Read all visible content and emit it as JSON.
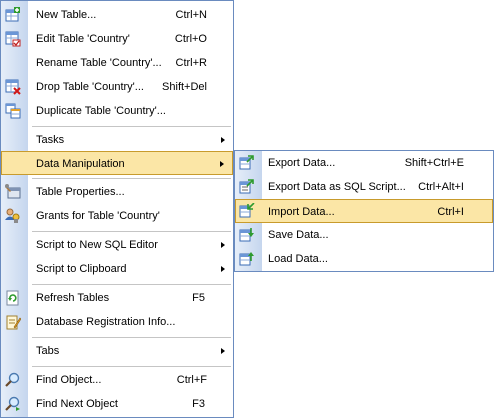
{
  "main_menu": {
    "new_table": {
      "label": "New Table...",
      "shortcut": "Ctrl+N",
      "icon": "new-table-icon"
    },
    "edit_table": {
      "label": "Edit Table 'Country'",
      "shortcut": "Ctrl+O",
      "icon": "edit-table-icon"
    },
    "rename_table": {
      "label": "Rename Table 'Country'...",
      "shortcut": "Ctrl+R"
    },
    "drop_table": {
      "label": "Drop Table 'Country'...",
      "shortcut": "Shift+Del",
      "icon": "drop-table-icon"
    },
    "duplicate_table": {
      "label": "Duplicate Table 'Country'...",
      "icon": "duplicate-table-icon"
    },
    "tasks": {
      "label": "Tasks"
    },
    "data_manipulation": {
      "label": "Data Manipulation"
    },
    "table_properties": {
      "label": "Table Properties...",
      "icon": "table-properties-icon"
    },
    "grants": {
      "label": "Grants for Table 'Country'",
      "icon": "grants-icon"
    },
    "script_sql_editor": {
      "label": "Script to New SQL Editor"
    },
    "script_clipboard": {
      "label": "Script to Clipboard"
    },
    "refresh_tables": {
      "label": "Refresh Tables",
      "shortcut": "F5",
      "icon": "refresh-icon"
    },
    "db_registration": {
      "label": "Database Registration Info...",
      "icon": "db-registration-icon"
    },
    "tabs": {
      "label": "Tabs"
    },
    "find_object": {
      "label": "Find Object...",
      "shortcut": "Ctrl+F",
      "icon": "find-icon"
    },
    "find_next": {
      "label": "Find Next Object",
      "shortcut": "F3",
      "icon": "find-next-icon"
    }
  },
  "submenu": {
    "export_data": {
      "label": "Export Data...",
      "shortcut": "Shift+Ctrl+E",
      "icon": "export-data-icon"
    },
    "export_sql": {
      "label": "Export Data as SQL Script...",
      "shortcut": "Ctrl+Alt+I",
      "icon": "export-sql-icon"
    },
    "import_data": {
      "label": "Import Data...",
      "shortcut": "Ctrl+I",
      "icon": "import-data-icon"
    },
    "save_data": {
      "label": "Save Data...",
      "icon": "save-data-icon"
    },
    "load_data": {
      "label": "Load Data...",
      "icon": "load-data-icon"
    }
  },
  "colors": {
    "highlight": "#fbe6a6",
    "highlight_border": "#c89b2c",
    "gutter": "#c5d6ee",
    "menu_border": "#6a8bbf"
  }
}
